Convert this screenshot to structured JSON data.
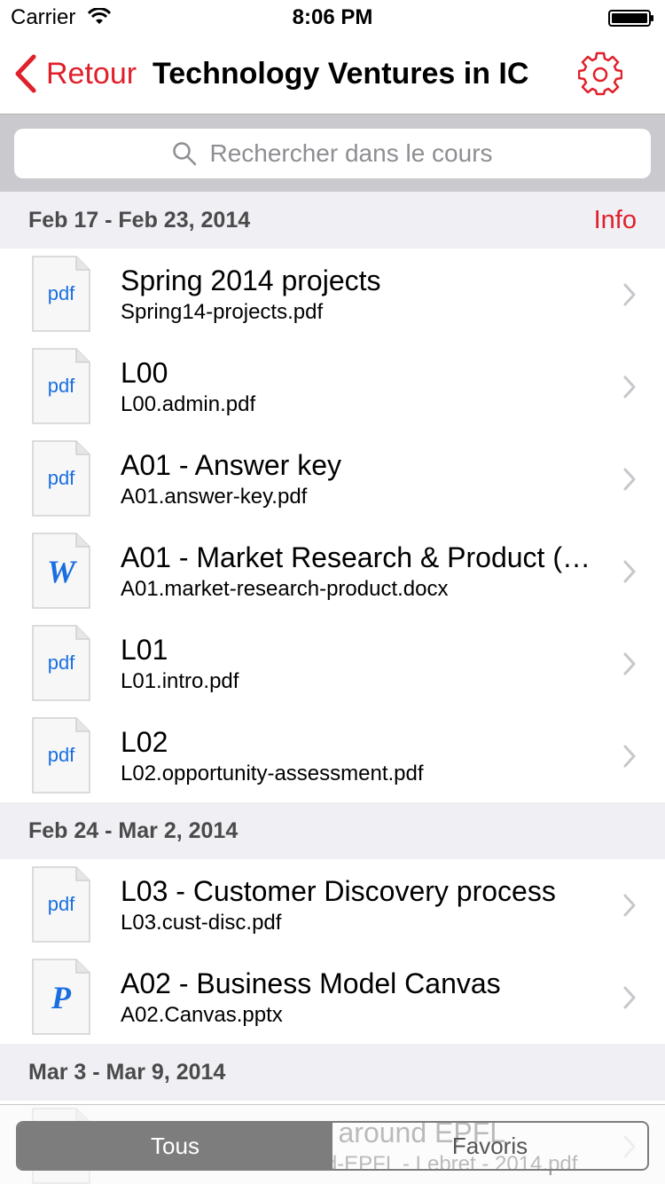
{
  "status": {
    "carrier": "Carrier",
    "time": "8:06 PM"
  },
  "nav": {
    "back_label": "Retour",
    "title": "Technology Ventures in IC"
  },
  "search": {
    "placeholder": "Rechercher dans le cours"
  },
  "colors": {
    "accent": "#e0202a",
    "doc_blue": "#1a6fe0",
    "section_bg": "#efeff4"
  },
  "sections": [
    {
      "title": "Feb 17 - Feb 23, 2014",
      "action": "Info",
      "items": [
        {
          "type": "pdf",
          "icon_label": "pdf",
          "title": "Spring 2014 projects",
          "file": "Spring14-projects.pdf"
        },
        {
          "type": "pdf",
          "icon_label": "pdf",
          "title": "L00",
          "file": "L00.admin.pdf"
        },
        {
          "type": "pdf",
          "icon_label": "pdf",
          "title": "A01 - Answer key",
          "file": "A01.answer-key.pdf"
        },
        {
          "type": "word",
          "icon_label": "W",
          "title": "A01 - Market Research & Product (e…",
          "file": "A01.market-research-product.docx"
        },
        {
          "type": "pdf",
          "icon_label": "pdf",
          "title": "L01",
          "file": "L01.intro.pdf"
        },
        {
          "type": "pdf",
          "icon_label": "pdf",
          "title": "L02",
          "file": "L02.opportunity-assessment.pdf"
        }
      ]
    },
    {
      "title": "Feb 24 - Mar 2, 2014",
      "items": [
        {
          "type": "pdf",
          "icon_label": "pdf",
          "title": "L03 - Customer Discovery process",
          "file": "L03.cust-disc.pdf"
        },
        {
          "type": "ppt",
          "icon_label": "P",
          "title": "A02 - Business Model Canvas",
          "file": "A02.Canvas.pptx"
        }
      ]
    },
    {
      "title": "Mar 3 - Mar 9, 2014",
      "items": [
        {
          "type": "pdf",
          "icon_label": "pdf",
          "title": "G01 - Innovation around EPFL",
          "file": "G01.innovation-around-EPFL - Lebret - 2014.pdf"
        }
      ]
    }
  ],
  "tabs": {
    "all_label": "Tous",
    "favorites_label": "Favoris",
    "selected": "Tous"
  }
}
